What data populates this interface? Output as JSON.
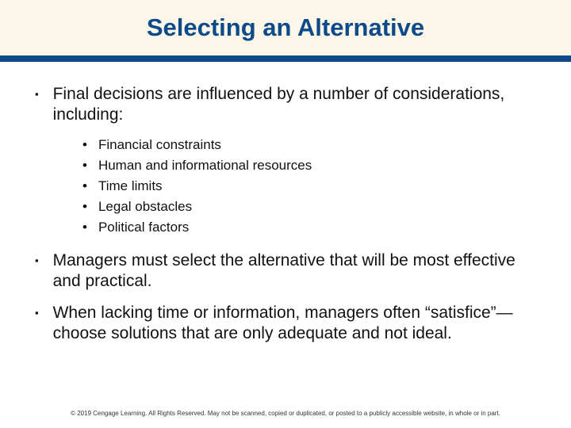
{
  "title": "Selecting an Alternative",
  "bullets_a": {
    "0": "Final decisions are influenced by a number of considerations, including:"
  },
  "sub": {
    "0": "Financial constraints",
    "1": "Human and informational resources",
    "2": "Time limits",
    "3": "Legal obstacles",
    "4": "Political factors"
  },
  "bullets_b": {
    "0": "Managers must select the alternative that will be most effective and practical.",
    "1": "When lacking time or information, managers often “satisfice”—choose solutions that are only adequate and not ideal."
  },
  "marker": {
    "square": "▪",
    "dot": "•"
  },
  "footer": "© 2019 Cengage Learning. All Rights Reserved. May not be scanned, copied or duplicated, or posted to a publicly accessible website, in whole or in part."
}
